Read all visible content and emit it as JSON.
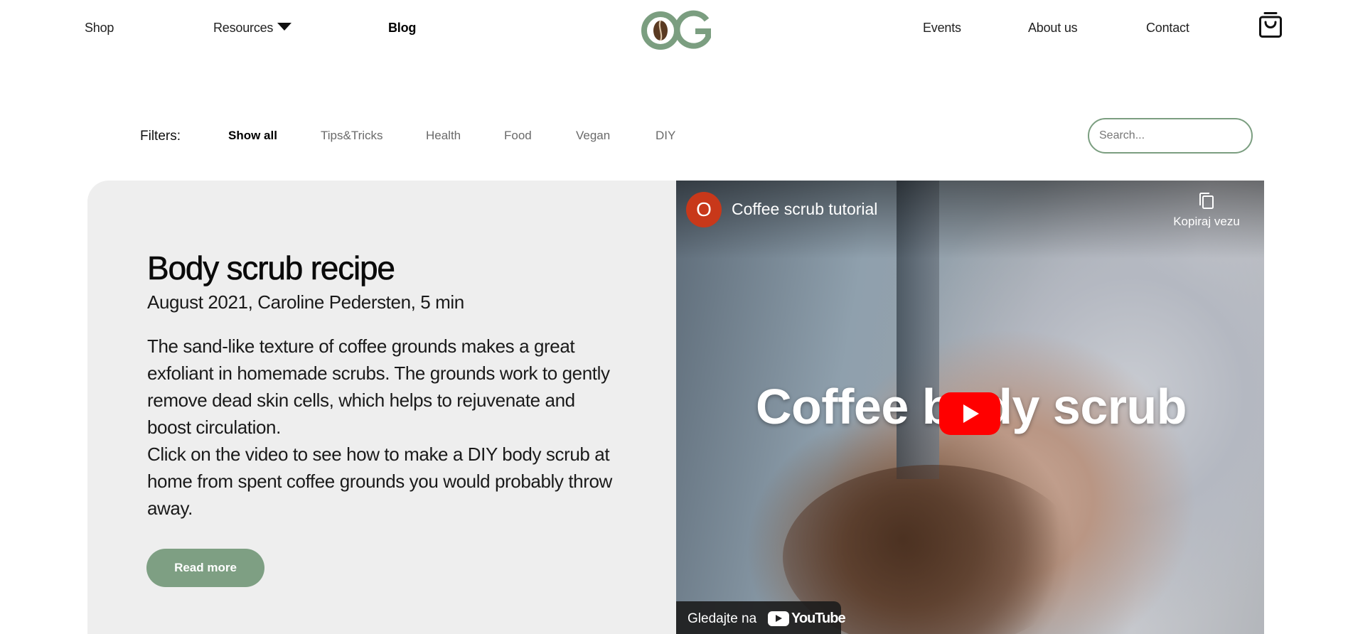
{
  "header": {
    "nav_left": {
      "shop": "Shop",
      "resources": "Resources",
      "blog": "Blog"
    },
    "nav_right": {
      "events": "Events",
      "about": "About us",
      "contact": "Contact"
    },
    "logo_icon": "og-coffee-bean-logo",
    "cart_icon": "shopping-bag-icon",
    "colors": {
      "brand_green": "#7b9e80",
      "bean_brown": "#5a3a22"
    }
  },
  "filters": {
    "label": "Filters:",
    "items": [
      "Show all",
      "Tips&Tricks",
      "Health",
      "Food",
      "Vegan",
      "DIY"
    ],
    "active": "Show all",
    "search_placeholder": "Search..."
  },
  "post": {
    "title": "Body scrub recipe",
    "meta": "August 2021, Caroline Pedersten, 5 min",
    "paragraph_1": "The sand-like texture of coffee grounds makes a great exfoliant in homemade scrubs. The grounds work to gently remove dead skin cells, which helps to rejuvenate and boost circulation.",
    "paragraph_2": "Click on the video to see how to make a DIY body scrub at home from spent coffee grounds you would probably throw away.",
    "read_more": "Read more",
    "button_color": "#7e9f83"
  },
  "video": {
    "channel_initial": "O",
    "title": "Coffee scrub tutorial",
    "copy_link": "Kopiraj vezu",
    "overlay_text": "Coffee body scrub",
    "watch_on": "Gledajte na",
    "platform": "YouTube",
    "play_color": "#ff0000",
    "avatar_color": "#c8381a"
  }
}
